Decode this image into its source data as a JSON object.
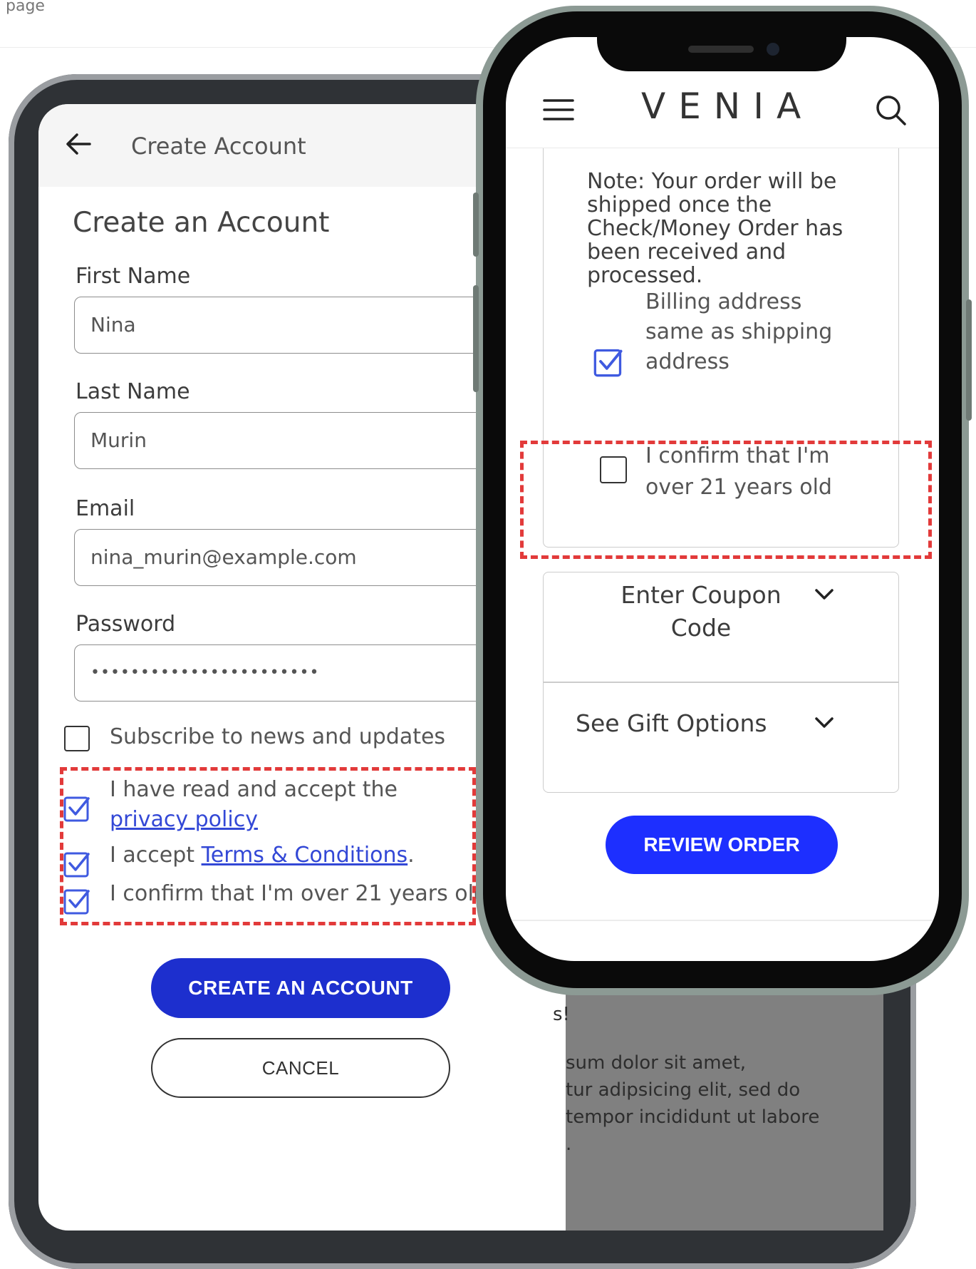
{
  "page_top_text": "page",
  "tablet": {
    "header": {
      "title": "Create Account"
    },
    "page_title": "Create an Account",
    "fields": [
      {
        "label": "First Name",
        "value": "Nina"
      },
      {
        "label": "Last Name",
        "value": "Murin"
      },
      {
        "label": "Email",
        "value": "nina_murin@example.com"
      },
      {
        "label": "Password",
        "value": "•••••••••••••••••••••••"
      }
    ],
    "subscribe_label": "Subscribe to news and updates",
    "privacy": {
      "prefix": "I have read and accept the",
      "link": "privacy policy"
    },
    "terms": {
      "prefix": "I accept ",
      "link": "Terms & Conditions",
      "suffix": "."
    },
    "age_confirm": "I confirm that I'm over 21 years old",
    "create_button": "CREATE AN ACCOUNT",
    "cancel_button": "CANCEL",
    "background_text": [
      "s!",
      "sum dolor sit amet,",
      "tur adipsicing elit, sed do",
      "tempor incididunt ut labore",
      "."
    ]
  },
  "phone": {
    "brand": "VENIA",
    "note": "Note: Your order will be shipped once the Check/Money Order has been received and processed.",
    "billing_same_line1": "Billing address",
    "billing_same_line2": "same as shipping",
    "billing_same_line3": "address",
    "age_confirm_line1": "I confirm that I'm",
    "age_confirm_line2": "over 21 years old",
    "coupon_line1": "Enter Coupon",
    "coupon_line2": "Code",
    "gift_options": "See Gift Options",
    "review_button": "REVIEW ORDER"
  },
  "colors": {
    "primary_button": "#1d2fce",
    "review_button": "#1d2fff",
    "highlight_dash": "#e23a3a",
    "checkbox_checked": "#3f5ae0",
    "link": "#3348d6"
  },
  "icons": [
    "arrow-left-icon",
    "menu-icon",
    "search-icon",
    "chevron-down-icon",
    "checkbox-checked-icon"
  ]
}
